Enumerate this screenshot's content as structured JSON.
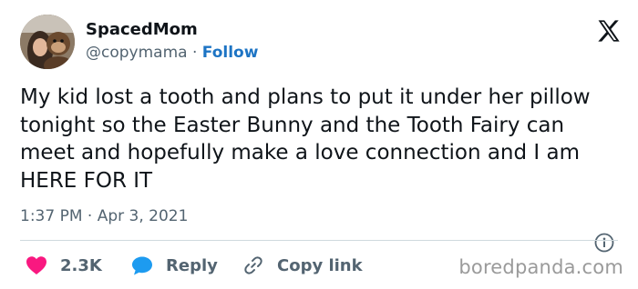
{
  "author": {
    "display_name": "SpacedMom",
    "handle": "@copymama",
    "separator": " · ",
    "follow_label": "Follow"
  },
  "tweet": {
    "text": "My kid lost a tooth and plans to put it under her pillow tonight so the Easter Bunny and the Tooth Fairy can meet and hopefully make a love connection and I am HERE FOR IT",
    "timestamp": "1:37 PM · Apr 3, 2021"
  },
  "actions": {
    "like_count": "2.3K",
    "reply_label": "Reply",
    "copy_link_label": "Copy link"
  },
  "icons": {
    "platform": "x-logo-icon",
    "info": "info-icon",
    "like": "heart-icon",
    "reply": "speech-bubble-icon",
    "copy": "link-icon"
  },
  "colors": {
    "like": "#f91880",
    "reply": "#1d9bf0",
    "follow": "#1d74c4",
    "secondary_text": "#536471"
  },
  "watermark": "boredpanda.com"
}
